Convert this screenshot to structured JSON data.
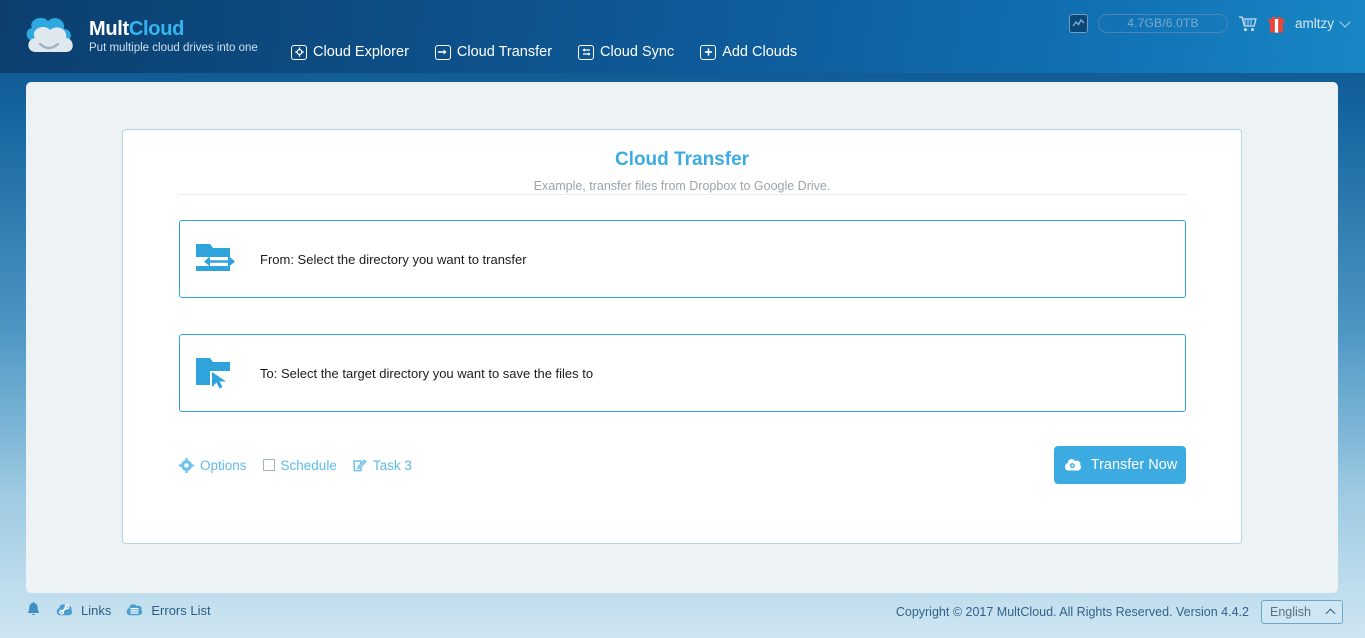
{
  "header": {
    "logo": {
      "name_part1": "Mult",
      "name_part2": "Cloud",
      "tagline": "Put multiple cloud drives into one",
      "icon": "cloud-logo-icon"
    },
    "nav": [
      {
        "label": "Cloud Explorer",
        "icon": "folder-gear-icon"
      },
      {
        "label": "Cloud Transfer",
        "icon": "folder-arrow-right-icon"
      },
      {
        "label": "Cloud Sync",
        "icon": "folder-sync-icon"
      },
      {
        "label": "Add Clouds",
        "icon": "folder-plus-icon"
      }
    ],
    "right": {
      "stat_icon": "traffic-stats-icon",
      "storage": "4.7GB/6.0TB",
      "cart_icon": "shopping-cart-icon",
      "gift_icon": "gift-icon",
      "username": "amltzy",
      "user_chevron": "chevron-down-icon"
    }
  },
  "card": {
    "title": "Cloud Transfer",
    "subtitle": "Example, transfer files from Dropbox to Google Drive.",
    "from": {
      "text": "From: Select the directory you want to transfer",
      "icon": "folder-export-icon"
    },
    "to": {
      "text": "To: Select the target directory you want to save the files to",
      "icon": "folder-cursor-icon"
    },
    "controls": {
      "options_label": "Options",
      "options_icon": "gear-icon",
      "schedule_label": "Schedule",
      "schedule_checked": false,
      "task_label": "Task 3",
      "task_icon": "edit-pencil-icon",
      "transfer_label": "Transfer Now",
      "transfer_icon": "cloud-transfer-icon"
    }
  },
  "footer": {
    "bell_icon": "bell-icon",
    "links_label": "Links",
    "links_icon": "cloud-link-icon",
    "errors_label": "Errors List",
    "errors_icon": "cloud-list-icon",
    "copyright": "Copyright © 2017 MultCloud. All Rights Reserved. Version 4.4.2",
    "language": "English",
    "language_chevron": "chevron-up-icon"
  },
  "colors": {
    "accent": "#3cabe2",
    "header_dark": "#0c3f6e",
    "title_blue": "#3babe2",
    "panel_bg": "#edf2f5",
    "border_blue": "#2ea3dc",
    "gift_red": "#e8483a"
  }
}
